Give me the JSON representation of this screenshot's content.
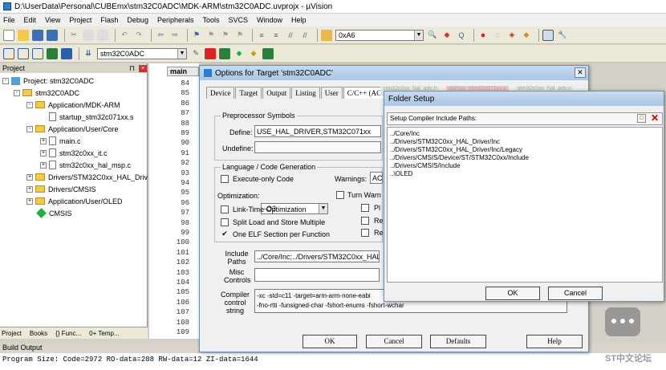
{
  "window_title": "D:\\UserData\\Personal\\CUBEmx\\stm32C0ADC\\MDK-ARM\\stm32C0ADC.uvprojx - µVision",
  "menu": [
    "File",
    "Edit",
    "View",
    "Project",
    "Flash",
    "Debug",
    "Peripherals",
    "Tools",
    "SVCS",
    "Window",
    "Help"
  ],
  "toolbar": {
    "find_value": "0xA6",
    "target_combo": "stm32C0ADC"
  },
  "project_panel": {
    "title": "Project",
    "root": "Project: stm32C0ADC",
    "target": "stm32C0ADC",
    "groups": [
      {
        "name": "Application/MDK-ARM",
        "files": [
          "startup_stm32c071xx.s"
        ]
      },
      {
        "name": "Application/User/Core",
        "files": [
          "main.c",
          "stm32c0xx_it.c",
          "stm32c0xx_hal_msp.c"
        ]
      },
      {
        "name": "Drivers/STM32C0xx_HAL_Driv",
        "files": []
      },
      {
        "name": "Drivers/CMSIS",
        "files": []
      },
      {
        "name": "Application/User/OLED",
        "files": []
      }
    ],
    "cmsis": "CMSIS",
    "tabs": [
      "Project",
      "Books",
      "{} Func...",
      "0+ Temp..."
    ]
  },
  "editor": {
    "tab": "main",
    "lines": [
      "84",
      "85",
      "86",
      "87",
      "88",
      "89",
      "90",
      "91",
      "92",
      "93",
      "94",
      "95",
      "96",
      "97",
      "98",
      "99",
      "100",
      "101",
      "102",
      "103",
      "104",
      "105",
      "106",
      "107",
      "108",
      "109"
    ]
  },
  "options_dialog": {
    "title": "Options for Target 'stm32C0ADC'",
    "tabs": [
      "Device",
      "Target",
      "Output",
      "Listing",
      "User",
      "C/C++ (AC6)"
    ],
    "preprocessor_label": "Preprocessor Symbols",
    "define_label": "Define:",
    "define_value": "USE_HAL_DRIVER,STM32C071xx",
    "undefine_label": "Undefine:",
    "lang_label": "Language / Code Generation",
    "execute_only": "Execute-only Code",
    "warnings_label": "Warnings:",
    "warnings_value": "AC",
    "optimization_label": "Optimization:",
    "optimization_value": "-O3",
    "turn_warn": "Turn Warn",
    "link_time": "Link-Time Optimization",
    "split_load": "Split Load and Store Multiple",
    "one_elf": "One ELF Section per Function",
    "side_labels": [
      "Pl",
      "Re",
      "Re"
    ],
    "include_label": "Include Paths",
    "include_value": "../Core/Inc;../Drivers/STM32C0xx_HAL_",
    "misc_label": "Misc Controls",
    "compiler_label": "Compiler control string",
    "compiler_line1": "-xc -std=c11 -target=arm-arm-none-eabi",
    "compiler_line2": "-fno-rtti -funsigned-char -fshort-enums -fshort-wchar",
    "buttons": {
      "ok": "OK",
      "cancel": "Cancel",
      "defaults": "Defaults",
      "help": "Help"
    }
  },
  "folder_setup": {
    "title": "Folder Setup",
    "list_label": "Setup Compiler Include Paths:",
    "paths": [
      "../Core/Inc",
      "../Drivers/STM32C0xx_HAL_Driver/Inc",
      "../Drivers/STM32C0xx_HAL_Driver/Inc/Legacy",
      "../Drivers/CMSIS/Device/ST/STM32C0xx/Include",
      "../Drivers/CMSIS/Include",
      "..\\OLED"
    ],
    "ok": "OK",
    "cancel": "Cancel"
  },
  "build": {
    "title": "Build Output",
    "line": "Program Size: Code=2972 RO-data=288 RW-data=12 ZI-data=1644"
  },
  "watermark": "ST中文论坛"
}
